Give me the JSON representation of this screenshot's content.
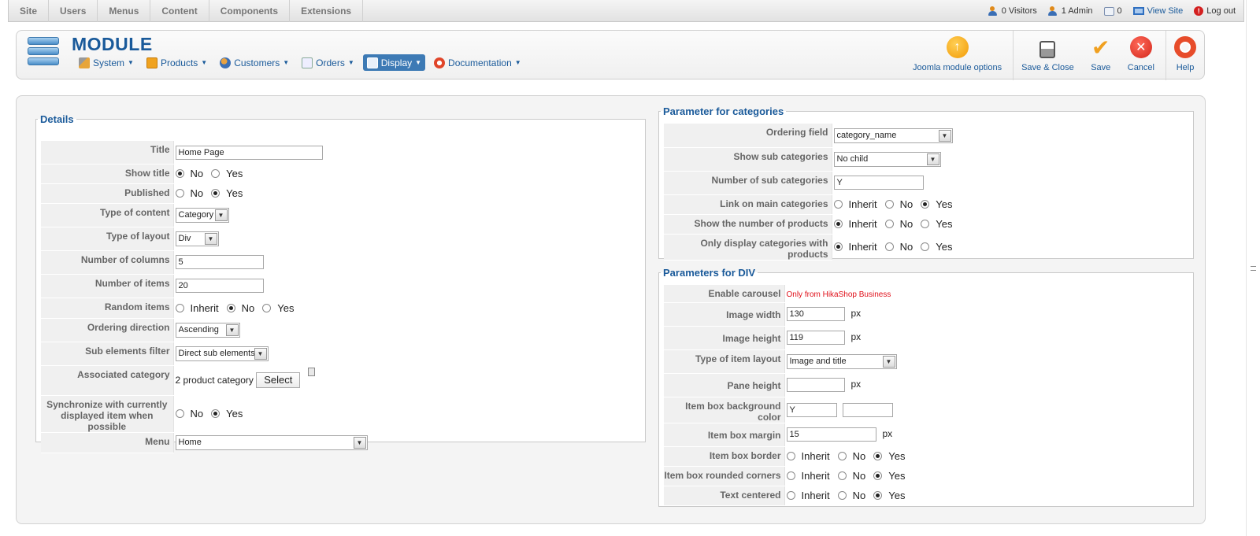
{
  "top_menu": [
    "Site",
    "Users",
    "Menus",
    "Content",
    "Components",
    "Extensions"
  ],
  "status": {
    "visitors": "0 Visitors",
    "admins": "1 Admin",
    "messages": "0",
    "view_site": "View Site",
    "logout": "Log out"
  },
  "header": {
    "title": "MODULE",
    "submenu": [
      "System",
      "Products",
      "Customers",
      "Orders",
      "Display",
      "Documentation"
    ],
    "active_submenu": "Display",
    "toolbar": {
      "options": "Joomla module options",
      "save_close": "Save & Close",
      "save": "Save",
      "cancel": "Cancel",
      "help": "Help"
    }
  },
  "details": {
    "legend": "Details",
    "title_label": "Title",
    "title_value": "Home Page",
    "show_title_label": "Show title",
    "published_label": "Published",
    "type_content_label": "Type of content",
    "type_content_value": "Category",
    "type_layout_label": "Type of layout",
    "type_layout_value": "Div",
    "num_columns_label": "Number of columns",
    "num_columns_value": "5",
    "num_items_label": "Number of items",
    "num_items_value": "20",
    "random_label": "Random items",
    "ordering_dir_label": "Ordering direction",
    "ordering_dir_value": "Ascending",
    "sub_filter_label": "Sub elements filter",
    "sub_filter_value": "Direct sub elements",
    "assoc_label": "Associated category",
    "assoc_value": "2 product category",
    "select_button": "Select",
    "sync_label_1": "Synchronize with currently",
    "sync_label_2": "displayed item when possible",
    "menu_label": "Menu",
    "menu_value": "Home"
  },
  "radio_labels": {
    "no": "No",
    "yes": "Yes",
    "inherit": "Inherit"
  },
  "categories": {
    "legend": "Parameter for categories",
    "ordering_label": "Ordering field",
    "ordering_value": "category_name",
    "show_sub_label": "Show sub categories",
    "show_sub_value": "No child",
    "num_sub_label": "Number of sub categories",
    "num_sub_value": "Y",
    "link_main_label": "Link on main categories",
    "show_num_label": "Show the number of products",
    "only_display_label": "Only display categories with products"
  },
  "div_params": {
    "legend": "Parameters for DIV",
    "carousel_label": "Enable carousel",
    "carousel_note": "Only from HikaShop Business",
    "img_width_label": "Image width",
    "img_width_value": "130",
    "img_height_label": "Image height",
    "img_height_value": "119",
    "item_layout_label": "Type of item layout",
    "item_layout_value": "Image and title",
    "pane_height_label": "Pane height",
    "pane_height_value": "",
    "bg_color_label": "Item box background color",
    "bg_color_value": "Y",
    "margin_label": "Item box margin",
    "margin_value": "15",
    "border_label": "Item box border",
    "rounded_label": "Item box rounded corners",
    "centered_label": "Text centered",
    "unit": "px"
  }
}
